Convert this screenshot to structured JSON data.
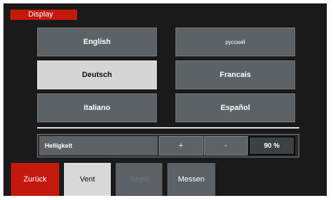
{
  "header": {
    "title": "Display"
  },
  "languages": [
    {
      "label": "English"
    },
    {
      "label": "русский"
    },
    {
      "label": "Deutsch"
    },
    {
      "label": "Francais"
    },
    {
      "label": "Italiano"
    },
    {
      "label": "Español"
    }
  ],
  "brightness": {
    "label": "Helligkeit",
    "plus_label": "+",
    "minus_label": "-",
    "value": "90 %"
  },
  "nav": {
    "back_label": "Zurück",
    "vent_label": "Vent",
    "regel_label": "Regel",
    "messen_label": "Messen"
  },
  "colors": {
    "accent": "#c41a0d",
    "button": "#5c6266",
    "selected": "#d6d6d6",
    "background": "#1a1a1a"
  }
}
